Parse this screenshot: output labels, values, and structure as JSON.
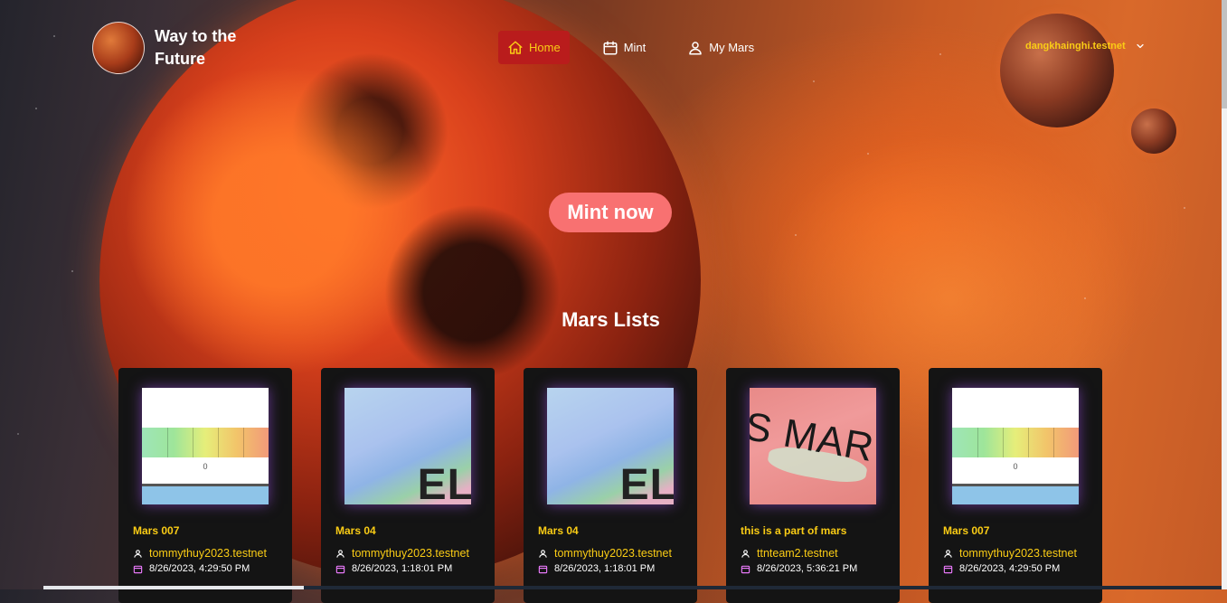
{
  "brand": {
    "title": "Way to the Future"
  },
  "nav": {
    "items": [
      {
        "label": "Home",
        "icon": "home-icon",
        "active": true
      },
      {
        "label": "Mint",
        "icon": "calendar-icon",
        "active": false
      },
      {
        "label": "My Mars",
        "icon": "user-icon",
        "active": false
      }
    ]
  },
  "account": {
    "name": "dangkhainghi.testnet",
    "icon": "chevron-down-icon"
  },
  "hero": {
    "mint_button": "Mint now"
  },
  "section": {
    "title": "Mars Lists"
  },
  "cards": [
    {
      "name": "Mars 007",
      "owner": "tommythuy2023.testnet",
      "date": "8/26/2023, 4:29:50 PM",
      "art": "bar"
    },
    {
      "name": "Mars 04",
      "owner": "tommythuy2023.testnet",
      "date": "8/26/2023, 1:18:01 PM",
      "art": "map",
      "label": "EL"
    },
    {
      "name": "Mars 04",
      "owner": "tommythuy2023.testnet",
      "date": "8/26/2023, 1:18:01 PM",
      "art": "map",
      "label": "EL"
    },
    {
      "name": "this is a part of mars",
      "owner": "ttnteam2.testnet",
      "date": "8/26/2023, 5:36:21 PM",
      "art": "mars",
      "label": "S MAR"
    },
    {
      "name": "Mars 007",
      "owner": "tommythuy2023.testnet",
      "date": "8/26/2023, 4:29:50 PM",
      "art": "bar"
    }
  ],
  "thumb_bar_label": "0",
  "colors": {
    "accent": "#facc15",
    "active_nav": "#b91c1c",
    "mint_button": "#f87171",
    "card_bg": "#141414"
  }
}
